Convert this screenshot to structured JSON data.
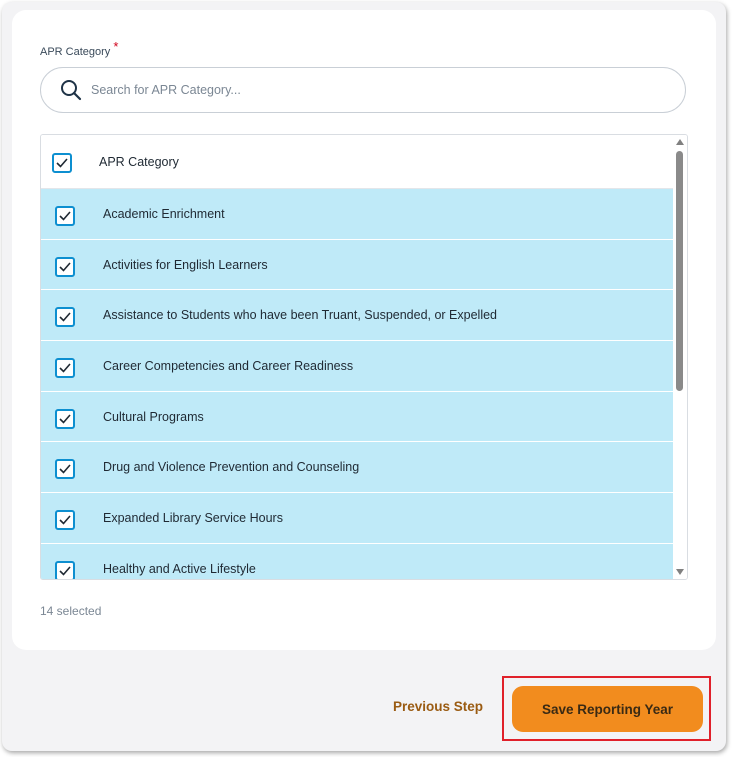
{
  "form": {
    "field_label": "APR Category",
    "required_marker": "*",
    "search": {
      "placeholder": "Search for APR Category..."
    },
    "list": {
      "header": "APR Category",
      "header_checked": true,
      "items": [
        {
          "label": "Academic Enrichment",
          "checked": true
        },
        {
          "label": "Activities for English Learners",
          "checked": true
        },
        {
          "label": "Assistance to Students who have been Truant, Suspended, or Expelled",
          "checked": true
        },
        {
          "label": "Career Competencies and Career Readiness",
          "checked": true
        },
        {
          "label": "Cultural Programs",
          "checked": true
        },
        {
          "label": "Drug and Violence Prevention and Counseling",
          "checked": true
        },
        {
          "label": "Expanded Library Service Hours",
          "checked": true
        },
        {
          "label": "Healthy and Active Lifestyle",
          "checked": true
        }
      ]
    },
    "selected_count": "14 selected"
  },
  "footer": {
    "previous_label": "Previous Step",
    "save_label": "Save Reporting Year"
  },
  "icons": {
    "search": "search-icon",
    "checkbox": "checkbox-checked-icon"
  },
  "colors": {
    "accent_orange": "#f28c1e",
    "row_selected": "#bfeaf8",
    "checkbox_blue": "#0d8fd0",
    "previous_link": "#9a5b12",
    "highlight_red": "#e0202a"
  }
}
